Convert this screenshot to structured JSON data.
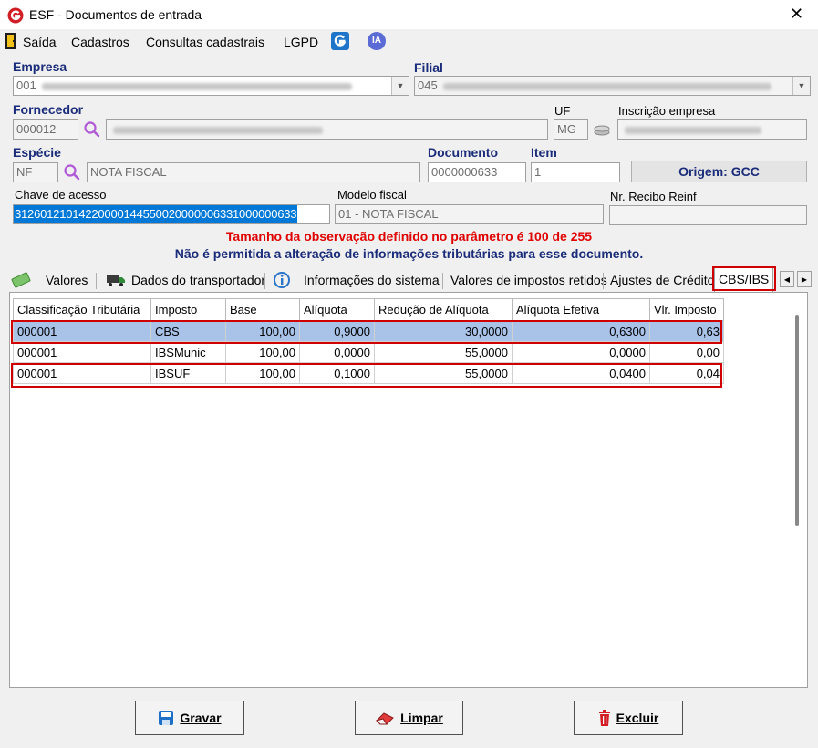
{
  "window": {
    "title": "ESF - Documentos de entrada",
    "close": "✕"
  },
  "menu": {
    "items": [
      "Saída",
      "Cadastros",
      "Consultas cadastrais",
      "LGPD"
    ],
    "ia_label": "IA"
  },
  "form": {
    "empresa": {
      "label": "Empresa",
      "value": "001"
    },
    "filial": {
      "label": "Filial",
      "value": "045"
    },
    "fornecedor": {
      "label": "Fornecedor",
      "value": "000012"
    },
    "uf": {
      "label": "UF",
      "value": "MG"
    },
    "inscricao": {
      "label": "Inscrição empresa"
    },
    "especie": {
      "label": "Espécie",
      "code": "NF",
      "desc": "NOTA FISCAL"
    },
    "documento": {
      "label": "Documento",
      "value": "0000000633"
    },
    "item": {
      "label": "Item",
      "value": "1"
    },
    "origem": {
      "label": "Origem: GCC"
    },
    "chave": {
      "label": "Chave de acesso",
      "value": "31260121014220000144550020000006331000000633"
    },
    "modelo": {
      "label": "Modelo fiscal",
      "value": "01 - NOTA FISCAL"
    },
    "recibo": {
      "label": "Nr. Recibo Reinf",
      "value": ""
    }
  },
  "messages": {
    "warning": "Tamanho da observação definido no parâmetro é 100 de 255",
    "info": "Não é permitida a alteração de informações tributárias para esse documento."
  },
  "tabs": [
    "Valores",
    "Dados do transportador",
    "Informações do sistema",
    "Valores de impostos retidos",
    "Ajustes de Crédito",
    "CBS/IBS"
  ],
  "tab_arrows": {
    "left": "◀",
    "right": "▶"
  },
  "grid": {
    "columns": [
      "Classificação Tributária",
      "Imposto",
      "Base",
      "Alíquota",
      "Redução de Alíquota",
      "Alíquota Efetiva",
      "Vlr. Imposto"
    ],
    "rows": [
      [
        "000001",
        "CBS",
        "100,00",
        "0,9000",
        "30,0000",
        "0,6300",
        "0,63"
      ],
      [
        "000001",
        "IBSMunic",
        "100,00",
        "0,0000",
        "55,0000",
        "0,0000",
        "0,00"
      ],
      [
        "000001",
        "IBSUF",
        "100,00",
        "0,1000",
        "55,0000",
        "0,0400",
        "0,04"
      ]
    ]
  },
  "buttons": {
    "gravar": "Gravar",
    "limpar": "Limpar",
    "excluir": "Excluir"
  },
  "colors": {
    "accent_red": "#d00000",
    "label_blue": "#1a2c7a",
    "selection": "#a8c2e8"
  }
}
